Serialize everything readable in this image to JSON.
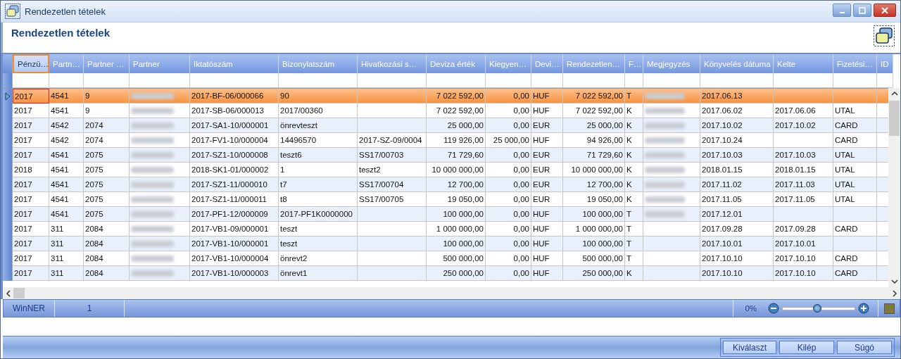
{
  "window": {
    "title": "Rendezetlen tételek"
  },
  "heading": "Rendezetlen tételek",
  "table": {
    "columns": [
      {
        "label": "Pénzü…",
        "selected": true
      },
      {
        "label": "Partn…",
        "selected": false
      },
      {
        "label": "Partner …",
        "selected": false
      },
      {
        "label": "Partner",
        "selected": false
      },
      {
        "label": "Iktatószám",
        "selected": false
      },
      {
        "label": "Bizonylatszám",
        "selected": false
      },
      {
        "label": "Hivatkozási s…",
        "selected": false
      },
      {
        "label": "Deviza érték",
        "selected": false
      },
      {
        "label": "Kiegyen…",
        "selected": false
      },
      {
        "label": "Devi…",
        "selected": false
      },
      {
        "label": "Rendezetlen…",
        "selected": false
      },
      {
        "label": "F…",
        "selected": false
      },
      {
        "label": "Megjegyzés",
        "selected": false
      },
      {
        "label": "Könyvelés dátuma",
        "selected": false
      },
      {
        "label": "Kelte",
        "selected": false
      },
      {
        "label": "Fizetési…",
        "selected": false
      },
      {
        "label": "ID",
        "selected": false
      }
    ],
    "rows": [
      {
        "selected": true,
        "cells": [
          "2017",
          "4541",
          "9",
          {
            "kind": "redacted"
          },
          "2017-BF-06/000066",
          "90",
          null,
          "7 022 592,00",
          "0,00",
          "HUF",
          "7 022 592,00",
          "T",
          {
            "kind": "redacted"
          },
          "2017.06.13",
          null,
          null,
          null
        ]
      },
      {
        "selected": false,
        "cells": [
          "2017",
          "4541",
          "9",
          {
            "kind": "redacted"
          },
          "2017-SB-06/000013",
          "2017/00360",
          null,
          "7 022 592,00",
          "0,00",
          "HUF",
          "7 022 592,00",
          "K",
          {
            "kind": "redacted"
          },
          "2017.06.02",
          "2017.06.06",
          "UTAL",
          null
        ]
      },
      {
        "selected": false,
        "cells": [
          "2017",
          "4542",
          "2074",
          {
            "kind": "redacted"
          },
          "2017-SA1-10/000001",
          "önrevteszt",
          null,
          "25 000,00",
          "0,00",
          "EUR",
          "25 000,00",
          "K",
          {
            "kind": "redacted"
          },
          "2017.10.02",
          "2017.10.02",
          "CARD",
          null
        ]
      },
      {
        "selected": false,
        "cells": [
          "2017",
          "4542",
          "2074",
          {
            "kind": "redacted"
          },
          "2017-FV1-10/000004",
          "14496570",
          "2017-SZ-09/0004",
          "119 926,00",
          "25 000,00",
          "HUF",
          "94 926,00",
          "K",
          {
            "kind": "redacted"
          },
          "2017.10.24",
          null,
          "CARD",
          null
        ]
      },
      {
        "selected": false,
        "cells": [
          "2017",
          "4541",
          "2075",
          {
            "kind": "redacted"
          },
          "2017-SZ1-10/000008",
          "teszt6",
          "SS17/00703",
          "71 729,60",
          "0,00",
          "EUR",
          "71 729,60",
          "K",
          {
            "kind": "redacted"
          },
          "2017.10.03",
          "2017.10.03",
          "UTAL",
          null
        ]
      },
      {
        "selected": false,
        "cells": [
          "2018",
          "4541",
          "2075",
          {
            "kind": "redacted"
          },
          "2018-SK1-01/000002",
          "1",
          "teszt2",
          "10 000 000,00",
          "0,00",
          "EUR",
          "10 000 000,00",
          "K",
          {
            "kind": "redacted"
          },
          "2018.01.15",
          "2018.01.15",
          "UTAL",
          null
        ]
      },
      {
        "selected": false,
        "cells": [
          "2017",
          "4541",
          "2075",
          {
            "kind": "redacted"
          },
          "2017-SZ1-11/000010",
          "t7",
          "SS17/00704",
          "12 700,00",
          "0,00",
          "EUR",
          "12 700,00",
          "K",
          {
            "kind": "redacted"
          },
          "2017.11.02",
          "2017.11.03",
          "UTAL",
          null
        ]
      },
      {
        "selected": false,
        "cells": [
          "2017",
          "4541",
          "2075",
          {
            "kind": "redacted"
          },
          "2017-SZ1-11/000011",
          "t8",
          "SS17/00705",
          "19 050,00",
          "0,00",
          "EUR",
          "19 050,00",
          "K",
          {
            "kind": "redacted"
          },
          "2017.11.05",
          "2017.11.05",
          "UTAL",
          null
        ]
      },
      {
        "selected": false,
        "cells": [
          "2017",
          "4541",
          "2075",
          {
            "kind": "redacted"
          },
          "2017-PF1-12/000009",
          "2017-PF1K0000000",
          null,
          "100 000,00",
          "0,00",
          "HUF",
          "100 000,00",
          "T",
          {
            "kind": "redacted"
          },
          "2017.12.01",
          null,
          null,
          null
        ]
      },
      {
        "selected": false,
        "cells": [
          "2017",
          "311",
          "2084",
          {
            "kind": "redacted"
          },
          "2017-VB1-09/000001",
          "teszt",
          null,
          "1 000 000,00",
          "0,00",
          "HUF",
          "1 000 000,00",
          "T",
          null,
          "2017.09.28",
          "2017.09.28",
          "CARD",
          null
        ]
      },
      {
        "selected": false,
        "cells": [
          "2017",
          "311",
          "2084",
          {
            "kind": "redacted"
          },
          "2017-VB1-10/000001",
          "teszt",
          null,
          "100 000,00",
          "0,00",
          "HUF",
          "100 000,00",
          "T",
          null,
          "2017.10.01",
          "2017.10.01",
          null,
          null
        ]
      },
      {
        "selected": false,
        "cells": [
          "2017",
          "311",
          "2084",
          {
            "kind": "redacted"
          },
          "2017-VB1-10/000004",
          "önrevt2",
          null,
          "500 000,00",
          "0,00",
          "HUF",
          "500 000,00",
          "T",
          null,
          "2017.10.10",
          "2017.10.10",
          "CARD",
          null
        ]
      },
      {
        "selected": false,
        "cells": [
          "2017",
          "311",
          "2084",
          {
            "kind": "redacted"
          },
          "2017-VB1-10/000003",
          "önrevt1",
          null,
          "250 000,00",
          "0,00",
          "HUF",
          "250 000,00",
          "K",
          null,
          "2017.10.10",
          "2017.10.10",
          "CARD",
          null
        ]
      }
    ]
  },
  "status": {
    "app": "WinNER",
    "count": "1",
    "zoom": {
      "reading": "0%",
      "level": 0.48
    },
    "color": "#7f7a3a"
  },
  "buttons": [
    "Kiválaszt",
    "Kilép",
    "Súgó"
  ]
}
